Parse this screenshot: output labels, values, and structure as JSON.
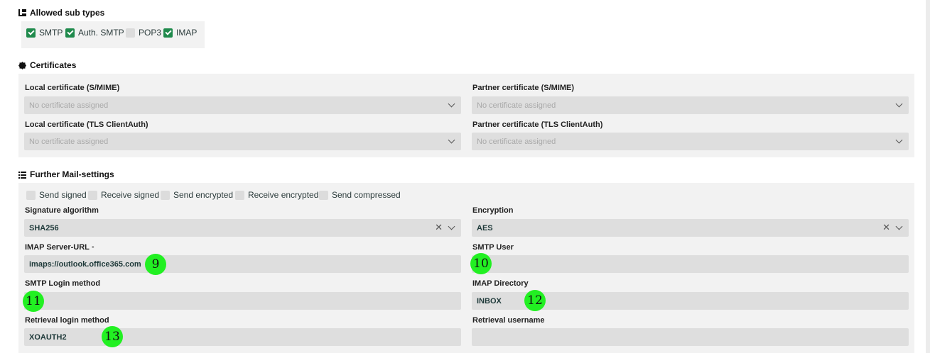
{
  "allowed_sub_types": {
    "title": "Allowed sub types",
    "icon": "tree-icon",
    "options": [
      {
        "label": "SMTP",
        "checked": true
      },
      {
        "label": "Auth. SMTP",
        "checked": true
      },
      {
        "label": "POP3",
        "checked": false
      },
      {
        "label": "IMAP",
        "checked": true
      }
    ]
  },
  "certificates": {
    "title": "Certificates",
    "icon": "certificate-icon",
    "local_smime": {
      "label": "Local certificate (S/MIME)",
      "placeholder": "No certificate assigned"
    },
    "partner_smime": {
      "label": "Partner certificate (S/MIME)",
      "placeholder": "No certificate assigned"
    },
    "local_tls": {
      "label": "Local certificate (TLS ClientAuth)",
      "placeholder": "No certificate assigned"
    },
    "partner_tls": {
      "label": "Partner certificate (TLS ClientAuth)",
      "placeholder": "No certificate assigned"
    }
  },
  "mail_settings": {
    "title": "Further Mail-settings",
    "icon": "list-icon",
    "flags": [
      {
        "label": "Send signed",
        "checked": false
      },
      {
        "label": "Receive signed",
        "checked": false
      },
      {
        "label": "Send encrypted",
        "checked": false
      },
      {
        "label": "Receive encrypted",
        "checked": false
      },
      {
        "label": "Send compressed",
        "checked": false
      }
    ],
    "signature_algorithm": {
      "label": "Signature algorithm",
      "value": "SHA256"
    },
    "encryption": {
      "label": "Encryption",
      "value": "AES"
    },
    "imap_server_url": {
      "label": "IMAP Server-URL",
      "required_mark": "•",
      "value": "imaps://outlook.office365.com"
    },
    "smtp_user": {
      "label": "SMTP User",
      "value": ""
    },
    "smtp_login_method": {
      "label": "SMTP Login method",
      "value": ""
    },
    "imap_directory": {
      "label": "IMAP Directory",
      "value": "INBOX"
    },
    "retrieval_login_method": {
      "label": "Retrieval login method",
      "value": "XOAUTH2"
    },
    "retrieval_username": {
      "label": "Retrieval username",
      "value": ""
    }
  },
  "markers": [
    "9",
    "10",
    "11",
    "12",
    "13"
  ],
  "colors": {
    "checkbox_checked": "#1f8a4c",
    "panel_bg": "#f2f2f2",
    "field_bg": "#dedede",
    "marker": "#22f022"
  }
}
